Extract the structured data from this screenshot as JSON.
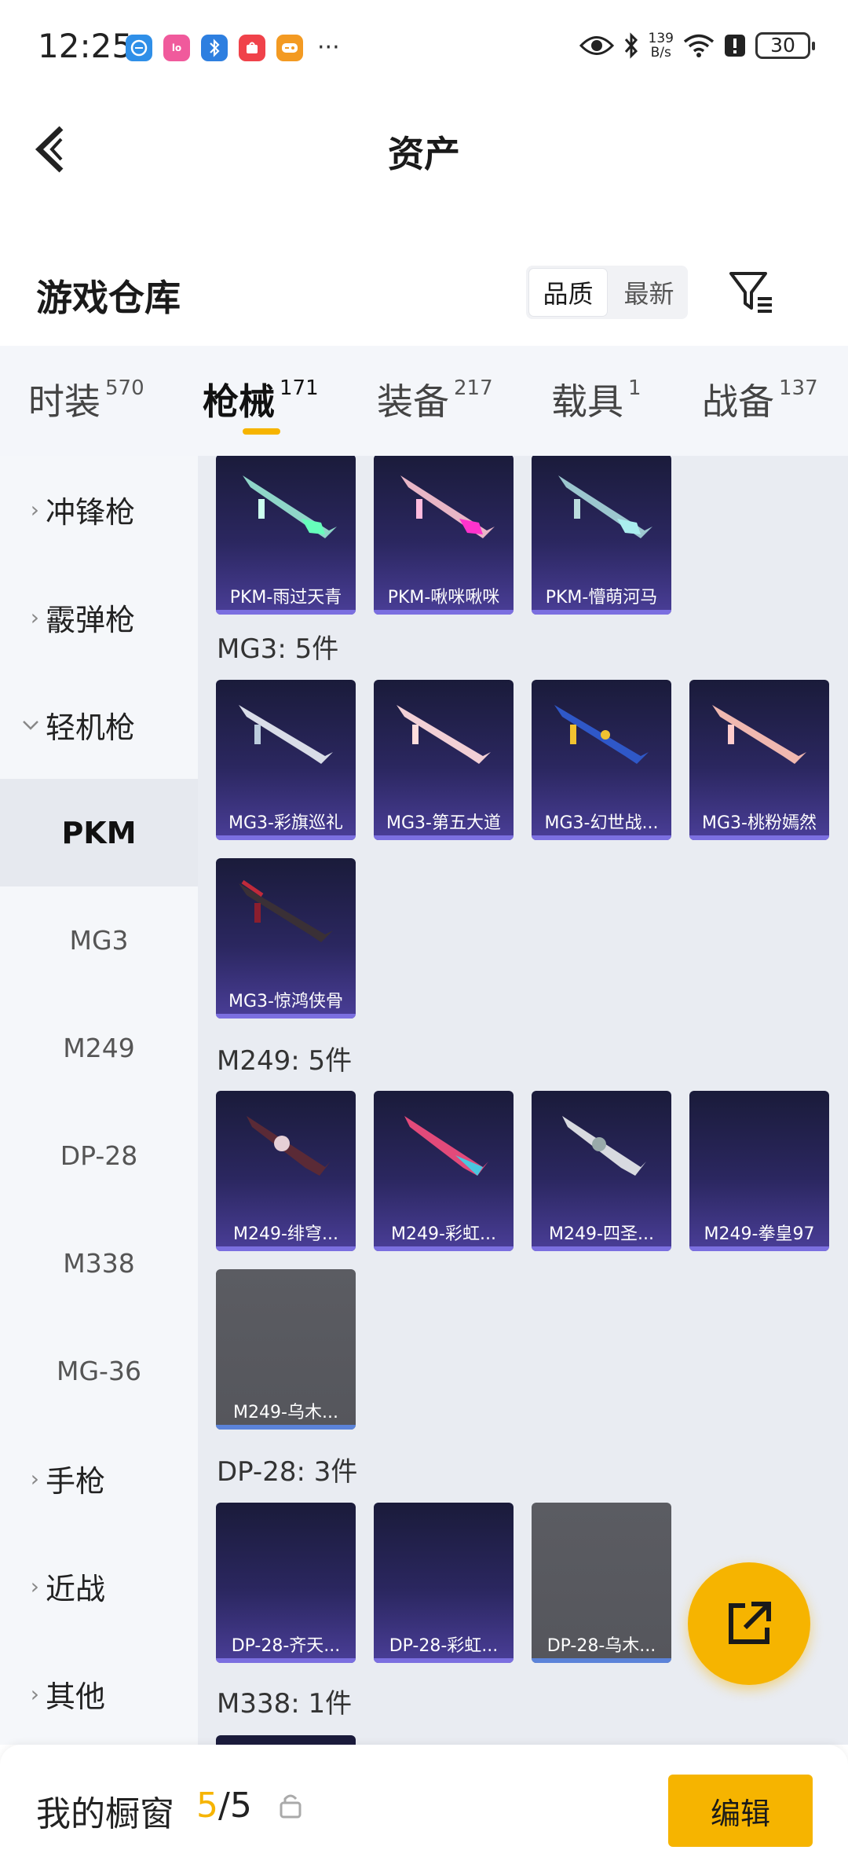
{
  "status_bar": {
    "time": "12:25",
    "net_speed_value": "139",
    "net_speed_unit": "B/s",
    "battery": "30",
    "notif_more": "···",
    "notif_icons": [
      {
        "name": "browser-app-icon",
        "color": "#2f8fe8",
        "glyph": "◉"
      },
      {
        "name": "lofter-app-icon",
        "color": "#f05a9c",
        "glyph": "lofi"
      },
      {
        "name": "bluetooth-notif-icon",
        "color": "#2e7fe0",
        "glyph": "ᛒ"
      },
      {
        "name": "shop-app-icon",
        "color": "#f0424a",
        "glyph": "▣"
      },
      {
        "name": "game-app-icon",
        "color": "#f39a22",
        "glyph": "🎮"
      }
    ]
  },
  "header": {
    "title": "资产"
  },
  "warehouse": {
    "title": "游戏仓库",
    "sort_options": [
      "品质",
      "最新"
    ],
    "active_sort": "品质"
  },
  "tabs": [
    {
      "label": "时装",
      "count": "570"
    },
    {
      "label": "枪械",
      "count": "171",
      "active": true
    },
    {
      "label": "装备",
      "count": "217"
    },
    {
      "label": "载具",
      "count": "1"
    },
    {
      "label": "战备",
      "count": "137"
    }
  ],
  "sidebar": {
    "categories": [
      "冲锋枪",
      "霰弹枪",
      "轻机枪"
    ],
    "subitems": [
      "PKM",
      "MG3",
      "M249",
      "DP-28",
      "M338",
      "MG-36"
    ],
    "selected_sub": "PKM",
    "more_categories": [
      "手枪",
      "近战",
      "其他"
    ]
  },
  "content": {
    "groups": [
      {
        "label": "",
        "items": [
          "PKM-雨过天青",
          "PKM-啾咪啾咪",
          "PKM-懵萌河马"
        ]
      },
      {
        "label": "MG3: 5件",
        "items": [
          "MG3-彩旗巡礼",
          "MG3-第五大道",
          "MG3-幻世战...",
          "MG3-桃粉嫣然",
          "MG3-惊鸿侠骨"
        ]
      },
      {
        "label": "M249: 5件",
        "items": [
          "M249-绯穹...",
          "M249-彩虹...",
          "M249-四圣...",
          "M249-拳皇97",
          "M249-乌木..."
        ]
      },
      {
        "label": "DP-28: 3件",
        "items": [
          "DP-28-齐天...",
          "DP-28-彩虹...",
          "DP-28-乌木..."
        ]
      },
      {
        "label": "M338: 1件",
        "items": []
      }
    ]
  },
  "bottom_bar": {
    "title": "我的橱窗",
    "current": "5",
    "separator": "/",
    "total": "5",
    "edit_label": "编辑"
  },
  "colors": {
    "accent": "#f6b400",
    "card_dark": "#2b2760",
    "card_grey": "#5b5c62"
  }
}
